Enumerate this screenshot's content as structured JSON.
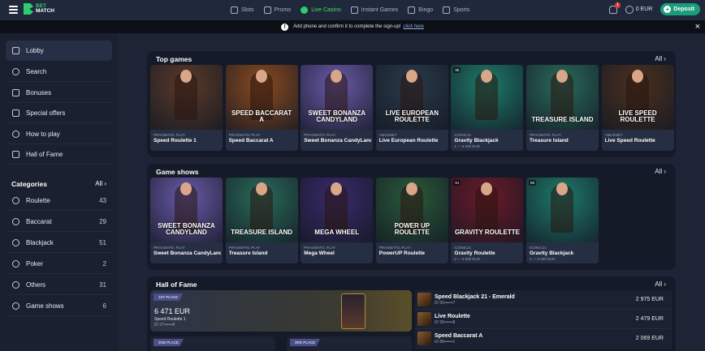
{
  "header": {
    "logo_top": "BET",
    "logo_bottom": "MATCH",
    "nav": [
      {
        "label": "Slots",
        "icon": "slots-icon",
        "active": false
      },
      {
        "label": "Promo",
        "icon": "promo-icon",
        "active": false
      },
      {
        "label": "Live Casino",
        "icon": "live-casino-icon",
        "active": true
      },
      {
        "label": "Instant Games",
        "icon": "instant-games-icon",
        "active": false
      },
      {
        "label": "Bingo",
        "icon": "bingo-icon",
        "active": false
      },
      {
        "label": "Sports",
        "icon": "sports-icon",
        "active": false
      }
    ],
    "notification_count": "1",
    "balance": "0 EUR",
    "deposit_label": "Deposit"
  },
  "notice": {
    "text": "Add phone and confirm it to complete the sign-up!",
    "link": "click here",
    "close": "×"
  },
  "sidebar": {
    "menu": [
      {
        "label": "Lobby",
        "icon": "home-icon"
      },
      {
        "label": "Search",
        "icon": "search-icon"
      },
      {
        "label": "Bonuses",
        "icon": "bonus-icon"
      },
      {
        "label": "Special offers",
        "icon": "offers-icon"
      },
      {
        "label": "How to play",
        "icon": "help-icon"
      },
      {
        "label": "Hall of Fame",
        "icon": "trophy-icon"
      }
    ],
    "categories_title": "Categories",
    "categories_all": "All",
    "categories": [
      {
        "label": "Roulette",
        "count": "43",
        "icon": "roulette-icon"
      },
      {
        "label": "Baccarat",
        "count": "29",
        "icon": "baccarat-icon"
      },
      {
        "label": "Blackjack",
        "count": "51",
        "icon": "blackjack-icon"
      },
      {
        "label": "Poker",
        "count": "2",
        "icon": "poker-icon"
      },
      {
        "label": "Others",
        "count": "31",
        "icon": "others-icon"
      },
      {
        "label": "Game shows",
        "count": "6",
        "icon": "game-shows-icon"
      }
    ]
  },
  "top_games": {
    "title": "Top games",
    "all": "All",
    "cards": [
      {
        "provider": "PRAGMATIC PLAY",
        "name": "Speed Roulette 1",
        "limit": "",
        "art": "",
        "badge": "",
        "bg": "#5a3a2a"
      },
      {
        "provider": "PRAGMATIC PLAY",
        "name": "Speed Baccarat A",
        "limit": "",
        "art": "SPEED BACCARAT A",
        "badge": "",
        "bg": "#8a4a20"
      },
      {
        "provider": "PRAGMATIC PLAY",
        "name": "Sweet Bonanza CandyLand",
        "limit": "",
        "art": "SWEET BONANZA CANDYLAND",
        "badge": "",
        "bg": "#6a5aa8"
      },
      {
        "provider": "AMUSNET",
        "name": "Live European Roulette",
        "limit": "",
        "art": "LIVE EUROPEAN ROULETTE",
        "badge": "",
        "bg": "#2a3a4a"
      },
      {
        "provider": "ICONIC21",
        "name": "Gravity Blackjack",
        "limit": "1 — 5 000 EUR",
        "art": "",
        "badge": "86",
        "bg": "#1e7a6a"
      },
      {
        "provider": "PRAGMATIC PLAY",
        "name": "Treasure Island",
        "limit": "",
        "art": "TREASURE ISLAND",
        "badge": "",
        "bg": "#2a6a5a"
      },
      {
        "provider": "AMUSNET",
        "name": "Live Speed Roulette",
        "limit": "",
        "art": "LIVE SPEED ROULETTE",
        "badge": "",
        "bg": "#4a3020"
      }
    ]
  },
  "game_shows": {
    "title": "Game shows",
    "all": "All",
    "cards": [
      {
        "provider": "PRAGMATIC PLAY",
        "name": "Sweet Bonanza CandyLand",
        "limit": "",
        "art": "SWEET BONANZA CANDYLAND",
        "badge": "",
        "bg": "#6a5aa8"
      },
      {
        "provider": "PRAGMATIC PLAY",
        "name": "Treasure Island",
        "limit": "",
        "art": "TREASURE ISLAND",
        "badge": "",
        "bg": "#2a6a5a"
      },
      {
        "provider": "PRAGMATIC PLAY",
        "name": "Mega Wheel",
        "limit": "",
        "art": "MEGA WHEEL",
        "badge": "",
        "bg": "#3a2a6a"
      },
      {
        "provider": "PRAGMATIC PLAY",
        "name": "PowerUP Roulette",
        "limit": "",
        "art": "POWER UP ROULETTE",
        "badge": "",
        "bg": "#2a5a3a"
      },
      {
        "provider": "ICONIC21",
        "name": "Gravity Roulette",
        "limit": "0 — 5 000 EUR",
        "art": "GRAVITY ROULETTE",
        "badge": "81",
        "bg": "#6a1a2a"
      },
      {
        "provider": "ICONIC21",
        "name": "Gravity Blackjack",
        "limit": "1 — 5 000 EUR",
        "art": "",
        "badge": "86",
        "bg": "#1e7a6a"
      }
    ]
  },
  "hall_of_fame": {
    "title": "Hall of Fame",
    "all": "All",
    "first_place": "1ST PLACE",
    "first_amount": "6 471 EUR",
    "first_game": "Speed Roulette 1",
    "first_id": "ID 27••••••8",
    "second_place": "2ND PLACE",
    "third_place": "3RD PLACE",
    "list": [
      {
        "name": "Speed Blackjack 21 - Emerald",
        "id": "ID 55••••••7",
        "amount": "2 975 EUR"
      },
      {
        "name": "Live Roulette",
        "id": "ID 99••••••8",
        "amount": "2 479 EUR"
      },
      {
        "name": "Speed Baccarat A",
        "id": "ID 88••••••1",
        "amount": "2 069 EUR"
      }
    ]
  },
  "colors": {
    "accent": "#2ecc71",
    "deposit": "#1a9e7a",
    "background": "#1e2436"
  }
}
